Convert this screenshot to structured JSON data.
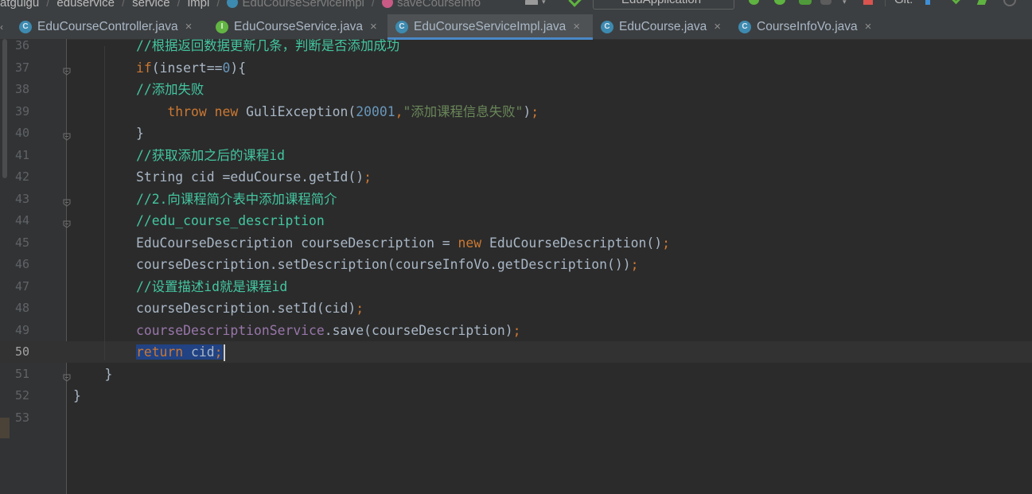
{
  "breadcrumb": {
    "items": [
      "atguigu",
      "eduservice",
      "service",
      "impl",
      "EduCourseServiceImpl",
      "saveCourseInfo"
    ]
  },
  "toolbar": {
    "run_config": "EduApplication",
    "git_label": "Git:"
  },
  "tabs": [
    {
      "label": "EduCourseController.java",
      "icon": "C",
      "kind": "class",
      "active": false
    },
    {
      "label": "EduCourseService.java",
      "icon": "I",
      "kind": "interface",
      "active": false
    },
    {
      "label": "EduCourseServiceImpl.java",
      "icon": "C",
      "kind": "class",
      "active": true
    },
    {
      "label": "EduCourse.java",
      "icon": "C",
      "kind": "class",
      "active": false
    },
    {
      "label": "CourseInfoVo.java",
      "icon": "C",
      "kind": "class",
      "active": false
    }
  ],
  "editor": {
    "caret_line": "50",
    "lines": [
      {
        "n": "36",
        "indent": "        ",
        "tokens": [
          {
            "t": "//根据返回数据更新几条，判断是否添加成功",
            "c": "cm"
          }
        ]
      },
      {
        "n": "37",
        "indent": "        ",
        "tokens": [
          {
            "t": "if",
            "c": "kw"
          },
          {
            "t": "(insert==",
            "c": "pl"
          },
          {
            "t": "0",
            "c": "num"
          },
          {
            "t": "){",
            "c": "pl"
          }
        ]
      },
      {
        "n": "38",
        "indent": "        ",
        "tokens": [
          {
            "t": "//添加失败",
            "c": "cm"
          }
        ]
      },
      {
        "n": "39",
        "indent": "            ",
        "tokens": [
          {
            "t": "throw new ",
            "c": "kw"
          },
          {
            "t": "GuliException(",
            "c": "pl"
          },
          {
            "t": "20001",
            "c": "num"
          },
          {
            "t": ",",
            "c": "kw"
          },
          {
            "t": "\"添加课程信息失败\"",
            "c": "str"
          },
          {
            "t": ")",
            "c": "pl"
          },
          {
            "t": ";",
            "c": "kw"
          }
        ]
      },
      {
        "n": "40",
        "indent": "        ",
        "tokens": [
          {
            "t": "}",
            "c": "pl"
          }
        ]
      },
      {
        "n": "41",
        "indent": "        ",
        "tokens": [
          {
            "t": "//获取添加之后的课程id",
            "c": "cm"
          }
        ]
      },
      {
        "n": "42",
        "indent": "        ",
        "tokens": [
          {
            "t": "String cid =eduCourse.getId()",
            "c": "pl"
          },
          {
            "t": ";",
            "c": "kw"
          }
        ]
      },
      {
        "n": "43",
        "indent": "        ",
        "tokens": [
          {
            "t": "//2.向课程简介表中添加课程简介",
            "c": "cm"
          }
        ]
      },
      {
        "n": "44",
        "indent": "        ",
        "tokens": [
          {
            "t": "//edu_course_description",
            "c": "cm"
          }
        ]
      },
      {
        "n": "45",
        "indent": "        ",
        "tokens": [
          {
            "t": "EduCourseDescription courseDescription = ",
            "c": "pl"
          },
          {
            "t": "new ",
            "c": "kw"
          },
          {
            "t": "EduCourseDescription()",
            "c": "pl"
          },
          {
            "t": ";",
            "c": "kw"
          }
        ]
      },
      {
        "n": "46",
        "indent": "        ",
        "tokens": [
          {
            "t": "courseDescription.setDescription(courseInfoVo.getDescription())",
            "c": "pl"
          },
          {
            "t": ";",
            "c": "kw"
          }
        ]
      },
      {
        "n": "47",
        "indent": "        ",
        "tokens": [
          {
            "t": "//设置描述id就是课程id",
            "c": "cm"
          }
        ]
      },
      {
        "n": "48",
        "indent": "        ",
        "tokens": [
          {
            "t": "courseDescription.setId(cid)",
            "c": "pl"
          },
          {
            "t": ";",
            "c": "kw"
          }
        ]
      },
      {
        "n": "49",
        "indent": "        ",
        "tokens": [
          {
            "t": "courseDescriptionService",
            "c": "fld"
          },
          {
            "t": ".save(courseDescription)",
            "c": "pl"
          },
          {
            "t": ";",
            "c": "kw"
          }
        ]
      },
      {
        "n": "50",
        "indent": "        ",
        "tokens": [
          {
            "t": "return ",
            "c": "kw",
            "sel": true
          },
          {
            "t": "cid",
            "c": "pl",
            "sel": true
          },
          {
            "t": ";",
            "c": "kw",
            "sel": true
          }
        ]
      },
      {
        "n": "51",
        "indent": "    ",
        "tokens": [
          {
            "t": "}",
            "c": "pl"
          }
        ]
      },
      {
        "n": "52",
        "indent": "",
        "tokens": [
          {
            "t": "}",
            "c": "pl"
          }
        ]
      },
      {
        "n": "53",
        "indent": "",
        "tokens": []
      }
    ],
    "fold_markers": [
      "37",
      "40",
      "43",
      "44",
      "51"
    ]
  },
  "colors": {
    "background": "#2b2b2b",
    "gutter": "#313335",
    "comment": "#43c6a0",
    "keyword": "#cc7832",
    "number": "#6897bb",
    "string": "#6a8759",
    "field": "#9876aa",
    "text": "#a9b7c6",
    "selection": "#214283",
    "tab_underline": "#4a88c7"
  }
}
